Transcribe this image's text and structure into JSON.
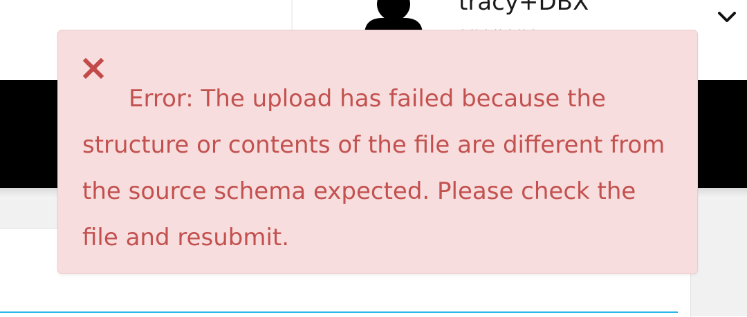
{
  "header": {
    "user": {
      "name": "tracy+DBX",
      "subtext": "· ·· · ·· · ·· ·",
      "avatar_icon": "user-silhouette-icon",
      "menu_icon": "chevron-down-icon"
    }
  },
  "alert": {
    "type": "error",
    "close_icon": "close-icon",
    "message": "Error: The upload has failed because the structure or contents of the file are different from the source schema expected. Please check the file and resubmit.",
    "colors": {
      "background": "#f7dddd",
      "border": "#eccaca",
      "text": "#c2514f",
      "icon": "#c24a48"
    }
  },
  "colors": {
    "nav_bar": "#000000",
    "accent": "#29b6e8"
  }
}
